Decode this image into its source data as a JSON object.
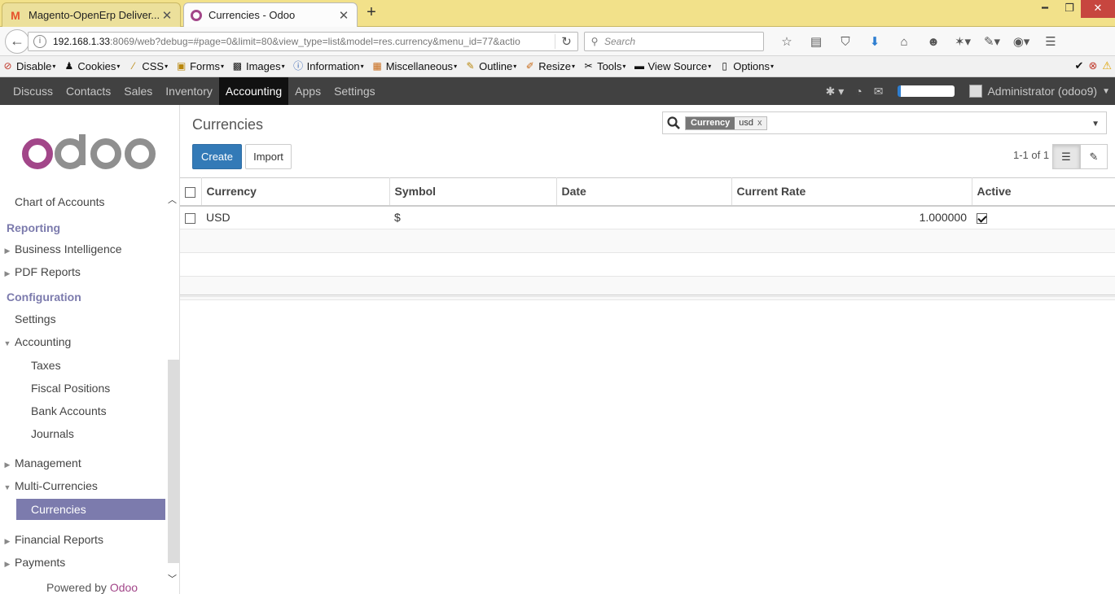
{
  "browser": {
    "tabs": [
      {
        "label": "Magento-OpenErp Deliver..."
      },
      {
        "label": "Currencies - Odoo"
      }
    ],
    "url": {
      "host": "192.168.1.33",
      "rest": ":8069/web?debug=#page=0&limit=80&view_type=list&model=res.currency&menu_id=77&actio"
    },
    "search_placeholder": "Search"
  },
  "devbar": [
    {
      "label": "Disable",
      "icon": "no-icon"
    },
    {
      "label": "Cookies",
      "icon": "person-icon"
    },
    {
      "label": "CSS",
      "icon": "wand-icon"
    },
    {
      "label": "Forms",
      "icon": "form-icon"
    },
    {
      "label": "Images",
      "icon": "image-icon"
    },
    {
      "label": "Information",
      "icon": "info-icon"
    },
    {
      "label": "Miscellaneous",
      "icon": "box-icon"
    },
    {
      "label": "Outline",
      "icon": "pencil-icon"
    },
    {
      "label": "Resize",
      "icon": "resize-icon"
    },
    {
      "label": "Tools",
      "icon": "tools-icon"
    },
    {
      "label": "View Source",
      "icon": "source-icon"
    },
    {
      "label": "Options",
      "icon": "options-icon"
    }
  ],
  "odoo_menu": [
    {
      "label": "Discuss"
    },
    {
      "label": "Contacts"
    },
    {
      "label": "Sales"
    },
    {
      "label": "Inventory"
    },
    {
      "label": "Accounting"
    },
    {
      "label": "Apps"
    },
    {
      "label": "Settings"
    }
  ],
  "user": {
    "label": "Administrator (odoo9)"
  },
  "sidebar": {
    "chart_of_accounts": "Chart of Accounts",
    "reporting_head": "Reporting",
    "business_intelligence": "Business Intelligence",
    "pdf_reports": "PDF Reports",
    "configuration_head": "Configuration",
    "settings": "Settings",
    "accounting": "Accounting",
    "taxes": "Taxes",
    "fiscal_positions": "Fiscal Positions",
    "bank_accounts": "Bank Accounts",
    "journals": "Journals",
    "management": "Management",
    "multi_currencies": "Multi-Currencies",
    "currencies": "Currencies",
    "financial_reports": "Financial Reports",
    "payments": "Payments",
    "powered_by": "Powered by",
    "powered_brand": "Odoo"
  },
  "main": {
    "title": "Currencies",
    "create_label": "Create",
    "import_label": "Import",
    "facet_name": "Currency",
    "facet_value": "usd",
    "facet_remove": "x",
    "pager": "1-1 of 1",
    "columns": {
      "currency": "Currency",
      "symbol": "Symbol",
      "date": "Date",
      "rate": "Current Rate",
      "active": "Active"
    },
    "rows": [
      {
        "currency": "USD",
        "symbol": "$",
        "date": "",
        "rate": "1.000000",
        "active": true
      }
    ]
  },
  "colors": {
    "odoo_purple": "#7c7bad",
    "brand": "#a24689",
    "primary": "#337ab7",
    "topbar": "#414141"
  }
}
